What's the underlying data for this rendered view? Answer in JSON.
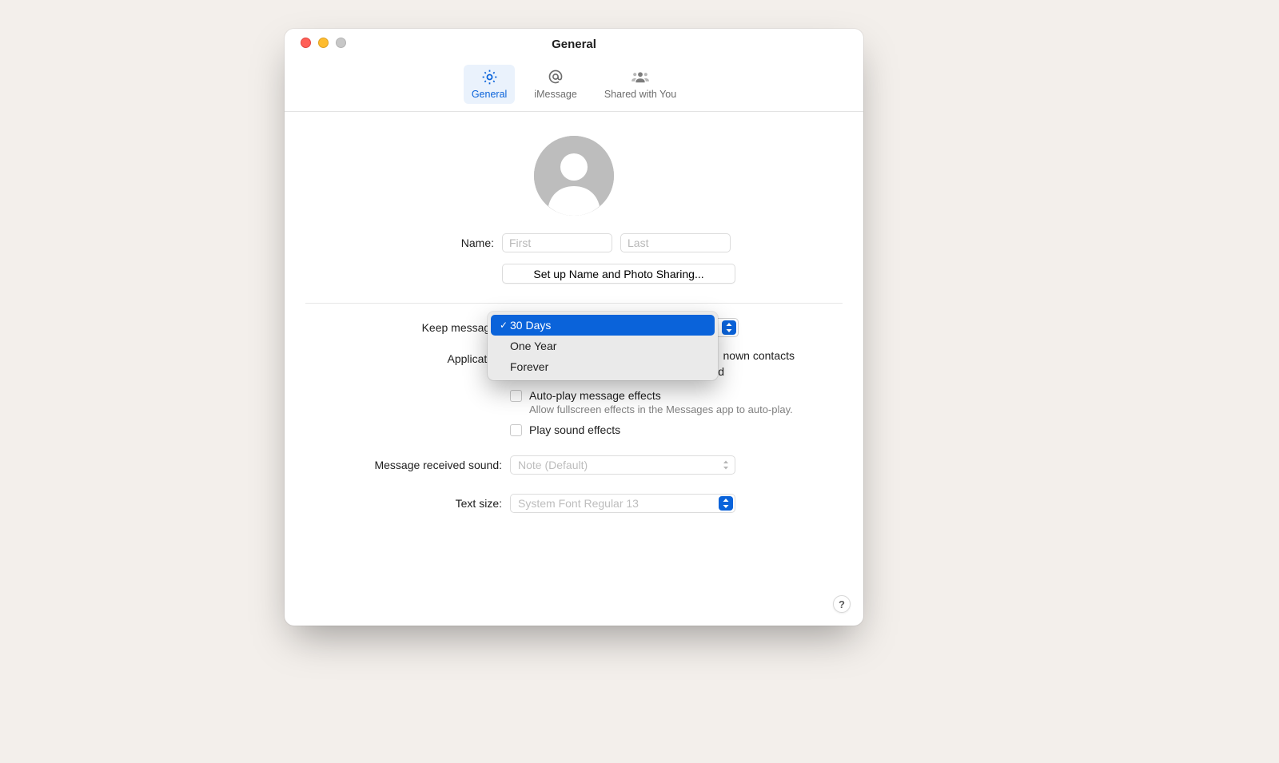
{
  "window": {
    "title": "General"
  },
  "toolbar": {
    "general": "General",
    "imessage": "iMessage",
    "shared": "Shared with You"
  },
  "profile": {
    "name_label": "Name:",
    "first_placeholder": "First",
    "last_placeholder": "Last",
    "setup_button": "Set up Name and Photo Sharing..."
  },
  "keep": {
    "label": "Keep messages",
    "options": [
      "30 Days",
      "One Year",
      "Forever"
    ],
    "selected_index": 0
  },
  "application": {
    "label": "Application",
    "unknown_trail": "nown contacts",
    "row_two_trail": "ed",
    "autoplay_label": "Auto-play message effects",
    "autoplay_sub": "Allow fullscreen effects in the Messages app to auto-play.",
    "sound_label": "Play sound effects"
  },
  "received_sound": {
    "label": "Message received sound:",
    "value": "Note (Default)"
  },
  "text_size": {
    "label": "Text size:",
    "value": "System Font Regular 13"
  },
  "help": {
    "glyph": "?"
  }
}
